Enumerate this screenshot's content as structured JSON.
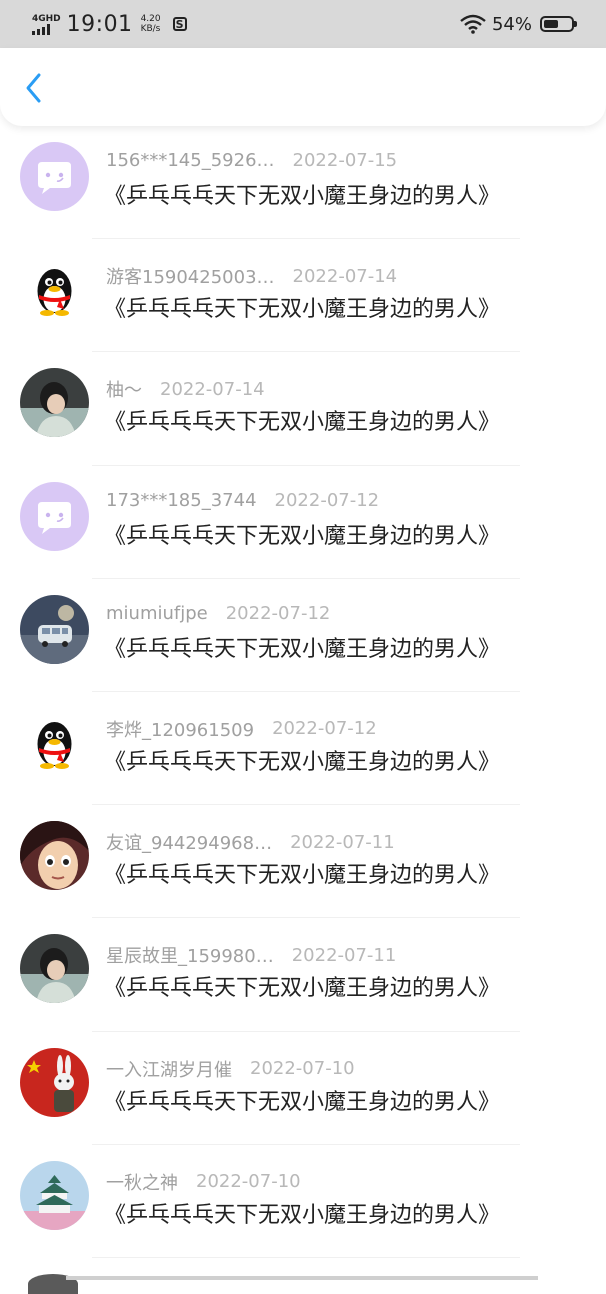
{
  "status_bar": {
    "network": "4GHD",
    "time": "19:01",
    "speed_value": "4.20",
    "speed_unit": "KB/s",
    "battery_percent": "54%",
    "battery_level": 0.54
  },
  "items": [
    {
      "name": "156***145_5926…",
      "date": "2022-07-15",
      "title": "《乒乓乓乓天下无双小魔王身边的男人》",
      "avatar": "chat-bubble-avatar"
    },
    {
      "name": "游客1590425003…",
      "date": "2022-07-14",
      "title": "《乒乓乓乓天下无双小魔王身边的男人》",
      "avatar": "qq-penguin-avatar"
    },
    {
      "name": "柚～",
      "date": "2022-07-14",
      "title": "《乒乓乓乓天下无双小魔王身边的男人》",
      "avatar": "photo-avatar"
    },
    {
      "name": "173***185_3744",
      "date": "2022-07-12",
      "title": "《乒乓乓乓天下无双小魔王身边的男人》",
      "avatar": "chat-bubble-avatar"
    },
    {
      "name": "miumiufjpe",
      "date": "2022-07-12",
      "title": "《乒乓乓乓天下无双小魔王身边的男人》",
      "avatar": "van-photo-avatar"
    },
    {
      "name": "李烨_120961509",
      "date": "2022-07-12",
      "title": "《乒乓乓乓天下无双小魔王身边的男人》",
      "avatar": "qq-penguin-avatar"
    },
    {
      "name": "友谊_944294968…",
      "date": "2022-07-11",
      "title": "《乒乓乓乓天下无双小魔王身边的男人》",
      "avatar": "cartoon-face-avatar"
    },
    {
      "name": "星辰故里_159980…",
      "date": "2022-07-11",
      "title": "《乒乓乓乓天下无双小魔王身边的男人》",
      "avatar": "photo-avatar"
    },
    {
      "name": "一入江湖岁月催",
      "date": "2022-07-10",
      "title": "《乒乓乓乓天下无双小魔王身边的男人》",
      "avatar": "rabbit-flag-avatar"
    },
    {
      "name": "一秋之神",
      "date": "2022-07-10",
      "title": "《乒乓乓乓天下无双小魔王身边的男人》",
      "avatar": "castle-photo-avatar"
    }
  ],
  "colors": {
    "accent": "#2a9df4",
    "bubble_avatar_bg": "#d9c8f5"
  }
}
